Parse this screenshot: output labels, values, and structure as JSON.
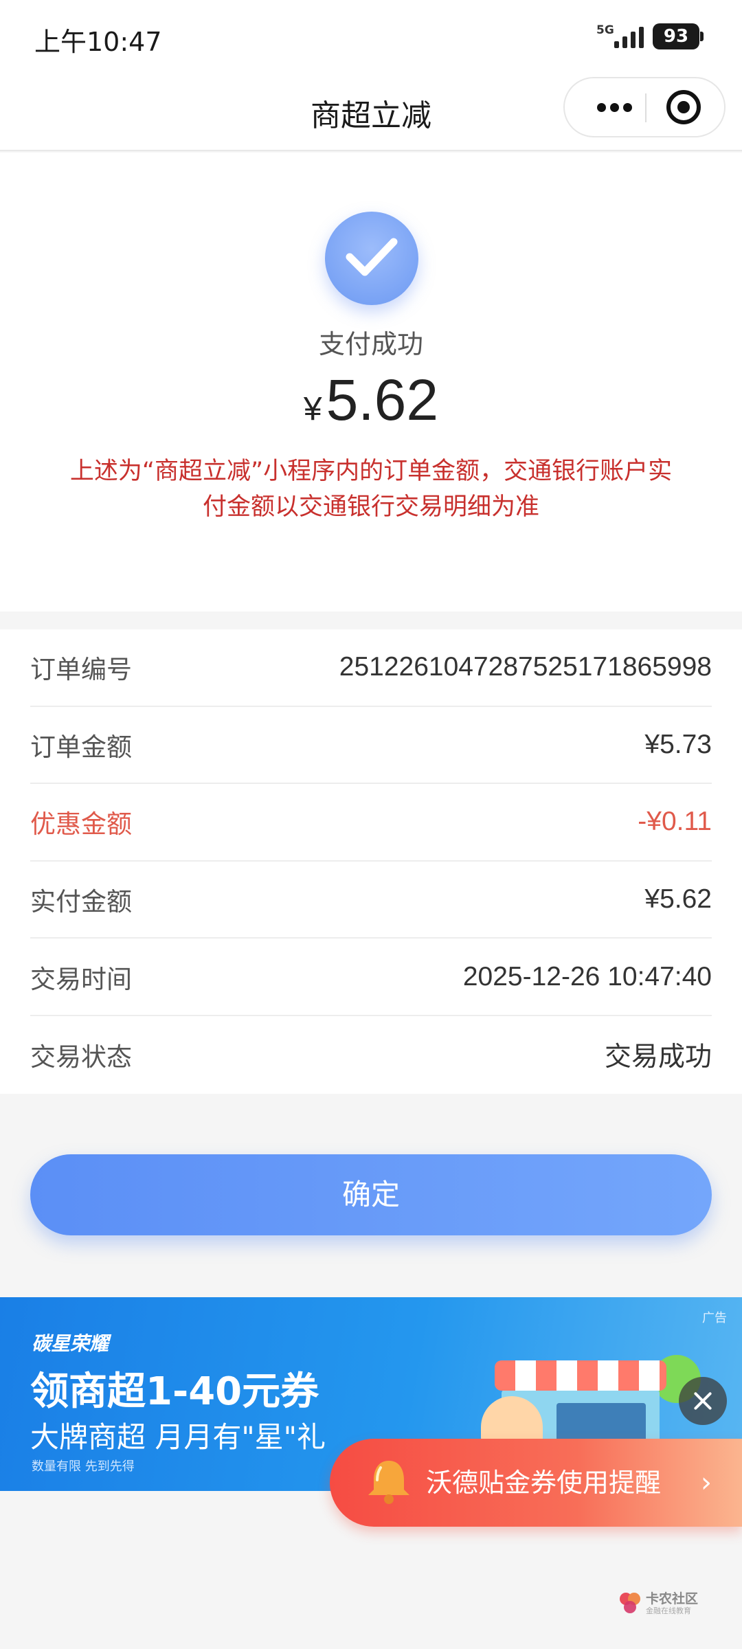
{
  "status_bar": {
    "time": "上午10:47",
    "network": "5G",
    "battery": "93"
  },
  "nav": {
    "title": "商超立减",
    "more_icon": "more-icon",
    "close_icon": "miniprogram-target-icon"
  },
  "result": {
    "status": "支付成功",
    "currency": "¥",
    "amount": "5.62",
    "notice": "上述为“商超立减”小程序内的订单金额，交通银行账户实付金额以交通银行交易明细为准"
  },
  "details": [
    {
      "label": "订单编号",
      "value": "2512261047287525171865998"
    },
    {
      "label": "订单金额",
      "value": "¥5.73"
    },
    {
      "label": "优惠金额",
      "value": "-¥0.11"
    },
    {
      "label": "实付金额",
      "value": "¥5.62"
    },
    {
      "label": "交易时间",
      "value": "2025-12-26 10:47:40"
    },
    {
      "label": "交易状态",
      "value": "交易成功"
    }
  ],
  "confirm_label": "确定",
  "ad": {
    "brand": "碳星荣耀",
    "tag": "广告",
    "headline": "领商超1-40元券",
    "subline": "大牌商超 月月有\"星\"礼",
    "fine_print": "数量有限 先到先得"
  },
  "reminder": {
    "text": "沃德贴金券使用提醒",
    "chevron": "›"
  },
  "watermark": {
    "name": "卡农社区",
    "slogan": "金融在线教育"
  },
  "colors": {
    "accent_blue": "#5b8ff6",
    "discount_red": "#e05a4b",
    "notice_red": "#c8302d"
  }
}
